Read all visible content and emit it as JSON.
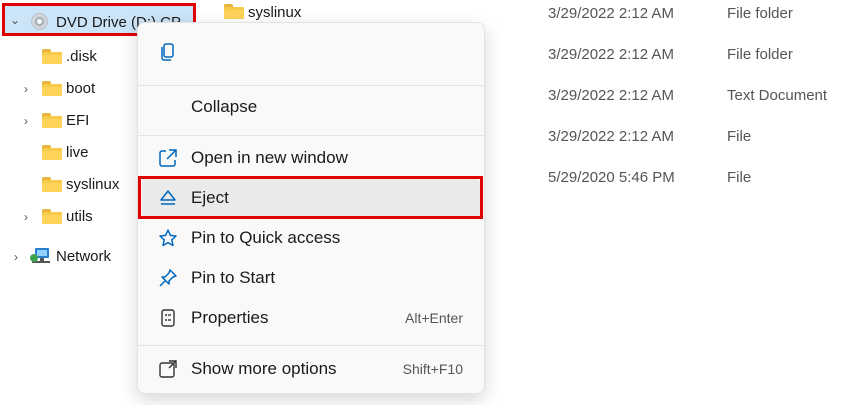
{
  "nav": {
    "dvd_drive_label": "DVD Drive (D:) CP...",
    "items": [
      {
        "label": ".disk",
        "expandable": false
      },
      {
        "label": "boot",
        "expandable": true
      },
      {
        "label": "EFI",
        "expandable": true
      },
      {
        "label": "live",
        "expandable": false
      },
      {
        "label": "syslinux",
        "expandable": false
      },
      {
        "label": "utils",
        "expandable": true
      }
    ],
    "network_label": "Network"
  },
  "files": [
    {
      "name": "syslinux",
      "date": "3/29/2022 2:12 AM",
      "type": "File folder"
    },
    {
      "name": "",
      "date": "3/29/2022 2:12 AM",
      "type": "File folder"
    },
    {
      "name": "",
      "date": "3/29/2022 2:12 AM",
      "type": "Text Document"
    },
    {
      "name": "",
      "date": "3/29/2022 2:12 AM",
      "type": "File"
    },
    {
      "name": "",
      "date": "5/29/2020 5:46 PM",
      "type": "File"
    }
  ],
  "context_menu": {
    "collapse": "Collapse",
    "open_new_window": "Open in new window",
    "eject": "Eject",
    "pin_quick_access": "Pin to Quick access",
    "pin_start": "Pin to Start",
    "properties": "Properties",
    "properties_shortcut": "Alt+Enter",
    "show_more": "Show more options",
    "show_more_shortcut": "Shift+F10"
  },
  "colors": {
    "accent": "#0067c0",
    "selection": "#cce4f7",
    "highlight_outline": "#e00000",
    "folder": "#f7c948"
  },
  "icons": [
    "copy-icon",
    "open-new-window-icon",
    "eject-icon",
    "star-icon",
    "pin-icon",
    "properties-icon",
    "show-more-icon",
    "disc-icon",
    "network-icon",
    "folder-icon"
  ]
}
